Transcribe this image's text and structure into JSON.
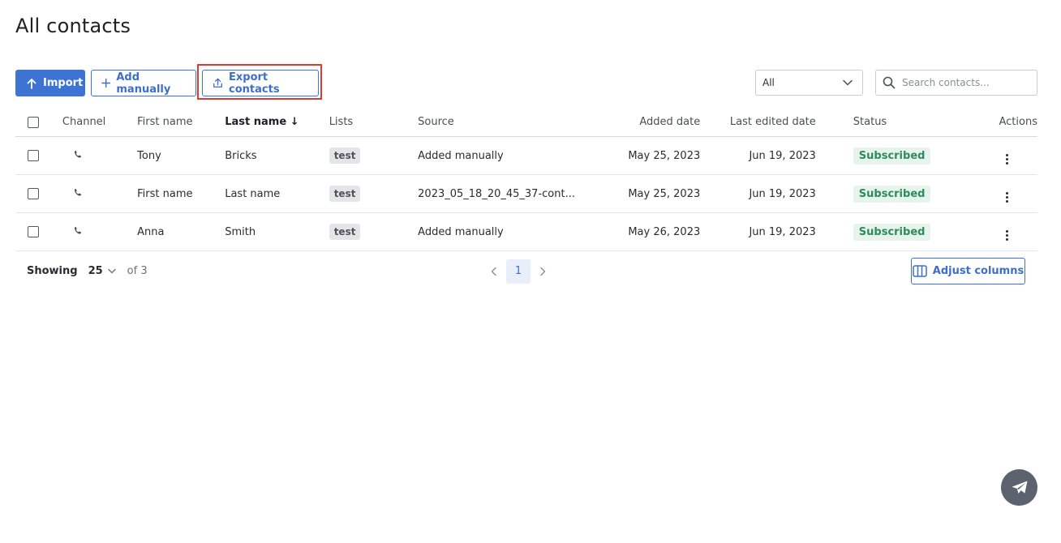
{
  "page": {
    "title": "All contacts"
  },
  "toolbar": {
    "import_label": "Import",
    "add_label": "Add manually",
    "export_label": "Export contacts",
    "filter_value": "All",
    "search_placeholder": "Search contacts..."
  },
  "table": {
    "headers": {
      "channel": "Channel",
      "first_name": "First name",
      "last_name": "Last name",
      "lists": "Lists",
      "source": "Source",
      "added": "Added date",
      "edited": "Last edited date",
      "status": "Status",
      "actions": "Actions"
    },
    "sort_indicator": "↓",
    "rows": [
      {
        "first": "Tony",
        "last": "Bricks",
        "list": "test",
        "source": "Added manually",
        "added": "May 25, 2023",
        "edited": "Jun 19, 2023",
        "status": "Subscribed"
      },
      {
        "first": "First name",
        "last": "Last name",
        "list": "test",
        "source": "2023_05_18_20_45_37-cont...",
        "added": "May 25, 2023",
        "edited": "Jun 19, 2023",
        "status": "Subscribed"
      },
      {
        "first": "Anna",
        "last": "Smith",
        "list": "test",
        "source": "Added manually",
        "added": "May 26, 2023",
        "edited": "Jun 19, 2023",
        "status": "Subscribed"
      }
    ]
  },
  "footer": {
    "showing_label": "Showing",
    "page_size": "25",
    "total": "of 3",
    "current_page": "1",
    "adjust_label": "Adjust columns"
  },
  "colors": {
    "primary": "#3d74d3",
    "highlight": "#dc3b2f",
    "subscribed_text": "#2e8b5a",
    "subscribed_bg": "#e7f4ee"
  },
  "icons": {
    "import": "arrow-up-icon",
    "add": "plus-icon",
    "export": "upload-icon",
    "filter": "chevron-down-icon",
    "search": "search-icon",
    "channel": "phone-icon",
    "actions": "kebab-menu-icon",
    "adjust": "columns-icon",
    "fab": "send-icon"
  }
}
